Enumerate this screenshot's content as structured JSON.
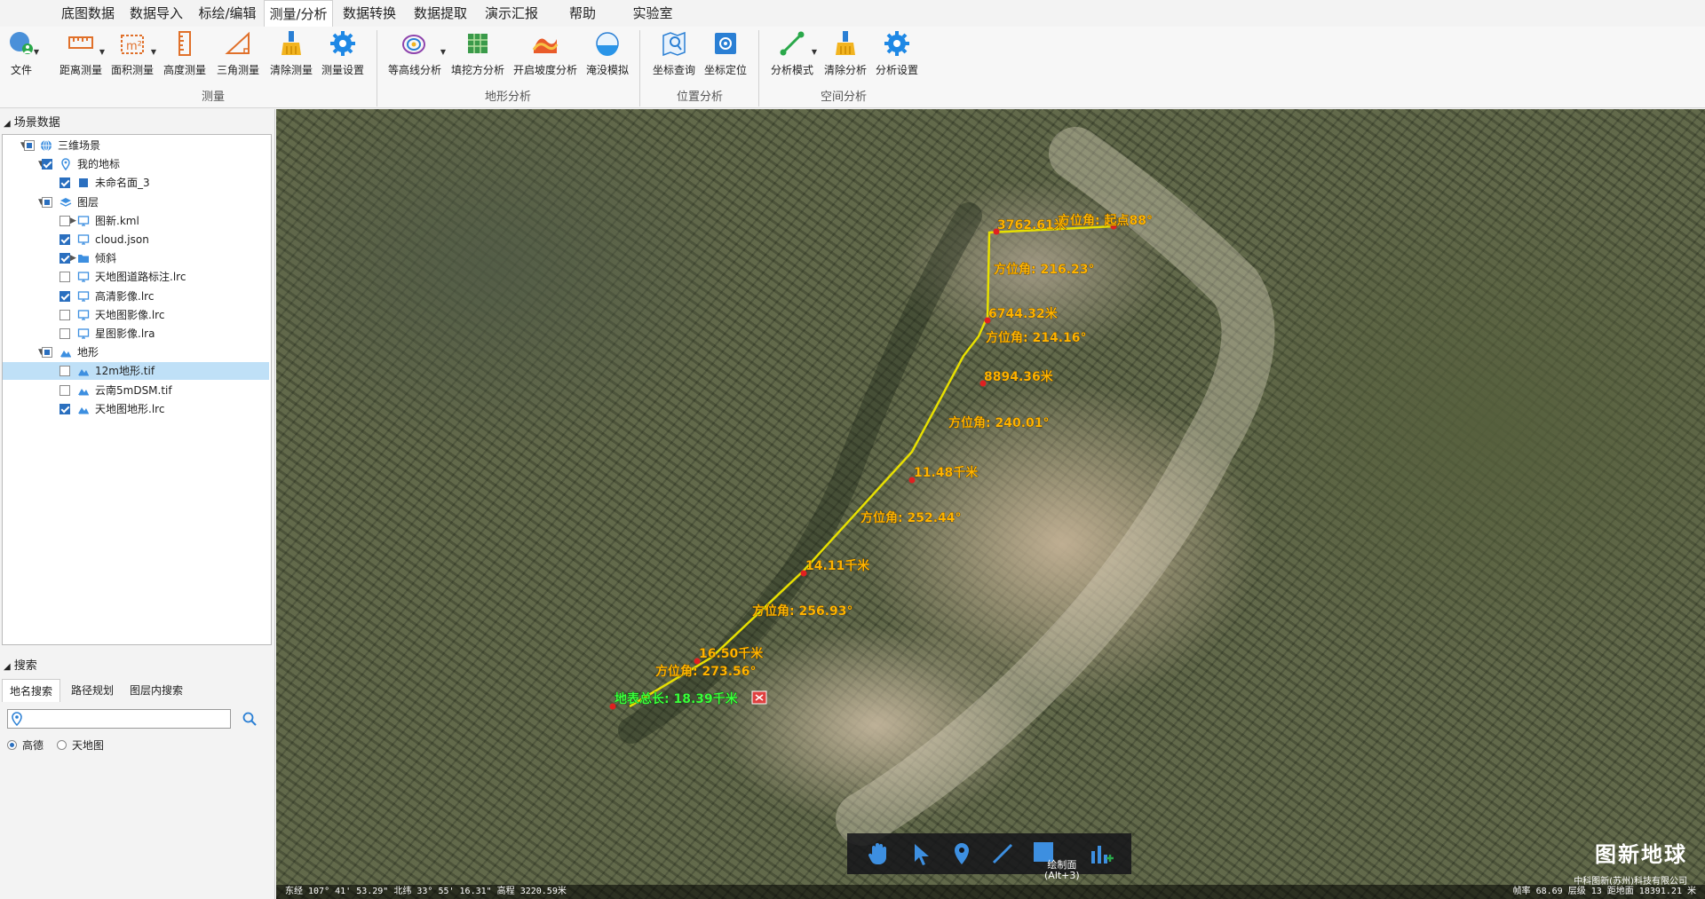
{
  "menu": {
    "items": [
      "底图数据",
      "数据导入",
      "标绘/编辑",
      "测量/分析",
      "数据转换",
      "数据提取",
      "演示汇报",
      "帮助",
      "实验室"
    ],
    "active_index": 3
  },
  "ribbon": {
    "file_label": "文件",
    "measure": {
      "caption": "测量",
      "buttons": [
        "距离测量",
        "面积测量",
        "高度测量",
        "三角测量",
        "清除测量",
        "测量设置"
      ]
    },
    "terrain": {
      "caption": "地形分析",
      "buttons": [
        "等高线分析",
        "填挖方分析",
        "开启坡度分析",
        "淹没模拟"
      ]
    },
    "position": {
      "caption": "位置分析",
      "buttons": [
        "坐标查询",
        "坐标定位"
      ]
    },
    "spatial": {
      "caption": "空间分析",
      "buttons": [
        "分析模式",
        "清除分析",
        "分析设置"
      ]
    }
  },
  "scene_panel": {
    "title": "场景数据",
    "tree": [
      {
        "label": "三维场景",
        "level": 0,
        "expanded": true,
        "check": "partial",
        "icon": "globe-icon"
      },
      {
        "label": "我的地标",
        "level": 1,
        "expanded": true,
        "check": "on",
        "icon": "pin-icon"
      },
      {
        "label": "未命名面_3",
        "level": 2,
        "check": "on",
        "icon": "polygon-icon"
      },
      {
        "label": "图层",
        "level": 1,
        "expanded": true,
        "check": "partial",
        "icon": "layers-icon"
      },
      {
        "label": "图新.kml",
        "level": 2,
        "collapsed": true,
        "check": "off",
        "icon": "monitor-icon"
      },
      {
        "label": "cloud.json",
        "level": 2,
        "check": "on",
        "icon": "monitor-icon"
      },
      {
        "label": "倾斜",
        "level": 2,
        "collapsed": true,
        "check": "on",
        "icon": "folder-icon"
      },
      {
        "label": "天地图道路标注.lrc",
        "level": 2,
        "check": "off",
        "icon": "monitor-icon"
      },
      {
        "label": "高清影像.lrc",
        "level": 2,
        "check": "on",
        "icon": "monitor-icon"
      },
      {
        "label": "天地图影像.lrc",
        "level": 2,
        "check": "off",
        "icon": "monitor-icon"
      },
      {
        "label": "星图影像.lra",
        "level": 2,
        "check": "off",
        "icon": "monitor-icon"
      },
      {
        "label": "地形",
        "level": 1,
        "expanded": true,
        "check": "partial",
        "icon": "terrain-icon"
      },
      {
        "label": "12m地形.tif",
        "level": 2,
        "check": "off",
        "icon": "terrain-icon",
        "selected": true
      },
      {
        "label": "云南5mDSM.tif",
        "level": 2,
        "check": "off",
        "icon": "terrain-icon"
      },
      {
        "label": "天地图地形.lrc",
        "level": 2,
        "check": "on",
        "icon": "terrain-icon"
      }
    ]
  },
  "search_panel": {
    "title": "搜索",
    "tabs": [
      "地名搜索",
      "路径规划",
      "图层内搜索"
    ],
    "active_tab": 0,
    "input_value": "",
    "input_placeholder": "",
    "sources": [
      {
        "label": "高德",
        "selected": true
      },
      {
        "label": "天地图",
        "selected": false
      }
    ]
  },
  "map": {
    "route_labels": [
      {
        "text": "3762.61米",
        "kind": "distance"
      },
      {
        "text": "方位角: 起点88°",
        "kind": "bearing"
      },
      {
        "text": "方位角: 216.23°",
        "kind": "bearing"
      },
      {
        "text": "6744.32米",
        "kind": "distance"
      },
      {
        "text": "方位角: 214.16°",
        "kind": "bearing"
      },
      {
        "text": "8894.36米",
        "kind": "distance"
      },
      {
        "text": "方位角: 240.01°",
        "kind": "bearing"
      },
      {
        "text": "11.48千米",
        "kind": "distance"
      },
      {
        "text": "方位角: 252.44°",
        "kind": "bearing"
      },
      {
        "text": "14.11千米",
        "kind": "distance"
      },
      {
        "text": "方位角: 256.93°",
        "kind": "bearing"
      },
      {
        "text": "16.50千米",
        "kind": "distance"
      },
      {
        "text": "方位角: 273.56°",
        "kind": "bearing"
      },
      {
        "text": "地表总长: 18.39千米",
        "kind": "total"
      }
    ],
    "toolbar": {
      "tools": [
        "hand-icon",
        "pointer-icon",
        "pin-icon",
        "line-icon",
        "polygon-icon",
        "chart-icon"
      ],
      "draw_face_label": "绘制面",
      "draw_face_shortcut": "(Alt+3)"
    },
    "brand_title": "图新地球",
    "brand_subtitle": "中科图新(苏州)科技有限公司",
    "status_left": "东经 107° 41' 53.29\"  北纬 33° 55' 16.31\"   高程 3220.59米",
    "status_right": "帧率 68.69    层级 13    距地面 18391.21 米",
    "route_color": "#e8e000",
    "label_color": "#ffb400",
    "total_color": "#3cff3c"
  }
}
